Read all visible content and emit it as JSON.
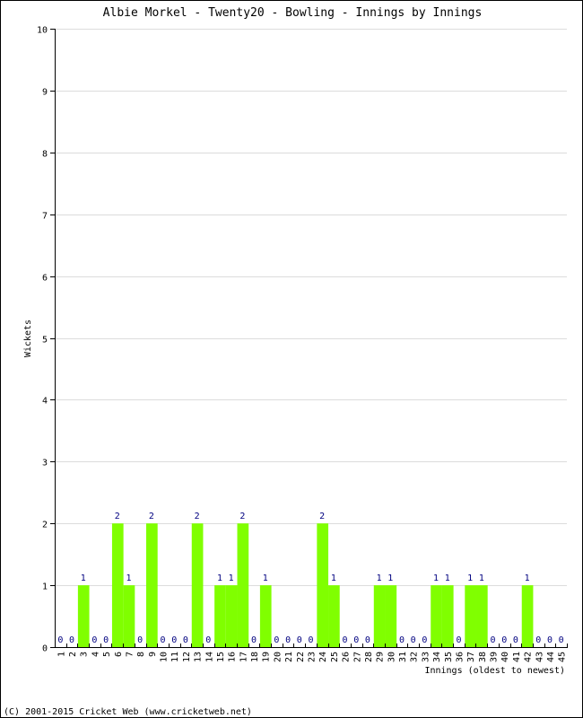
{
  "chart_data": {
    "type": "bar",
    "title": "Albie Morkel - Twenty20 - Bowling - Innings by Innings",
    "xlabel": "Innings (oldest to newest)",
    "ylabel": "Wickets",
    "ylim": [
      0,
      10
    ],
    "yticks": [
      0,
      1,
      2,
      3,
      4,
      5,
      6,
      7,
      8,
      9,
      10
    ],
    "grid": true,
    "categories": [
      "1",
      "2",
      "3",
      "4",
      "5",
      "6",
      "7",
      "8",
      "9",
      "10",
      "11",
      "12",
      "13",
      "14",
      "15",
      "16",
      "17",
      "18",
      "19",
      "20",
      "21",
      "22",
      "23",
      "24",
      "25",
      "26",
      "27",
      "28",
      "29",
      "30",
      "31",
      "32",
      "33",
      "34",
      "35",
      "36",
      "37",
      "38",
      "39",
      "40",
      "41",
      "42",
      "43",
      "44",
      "45"
    ],
    "values": [
      0,
      0,
      1,
      0,
      0,
      2,
      1,
      0,
      2,
      0,
      0,
      0,
      2,
      0,
      1,
      1,
      2,
      0,
      1,
      0,
      0,
      0,
      0,
      2,
      1,
      0,
      0,
      0,
      1,
      1,
      0,
      0,
      0,
      1,
      1,
      0,
      1,
      1,
      0,
      0,
      0,
      1,
      0,
      0,
      0
    ],
    "bar_color": "#80ff00",
    "label_color": "#000080"
  },
  "footer": "(C) 2001-2015 Cricket Web (www.cricketweb.net)"
}
